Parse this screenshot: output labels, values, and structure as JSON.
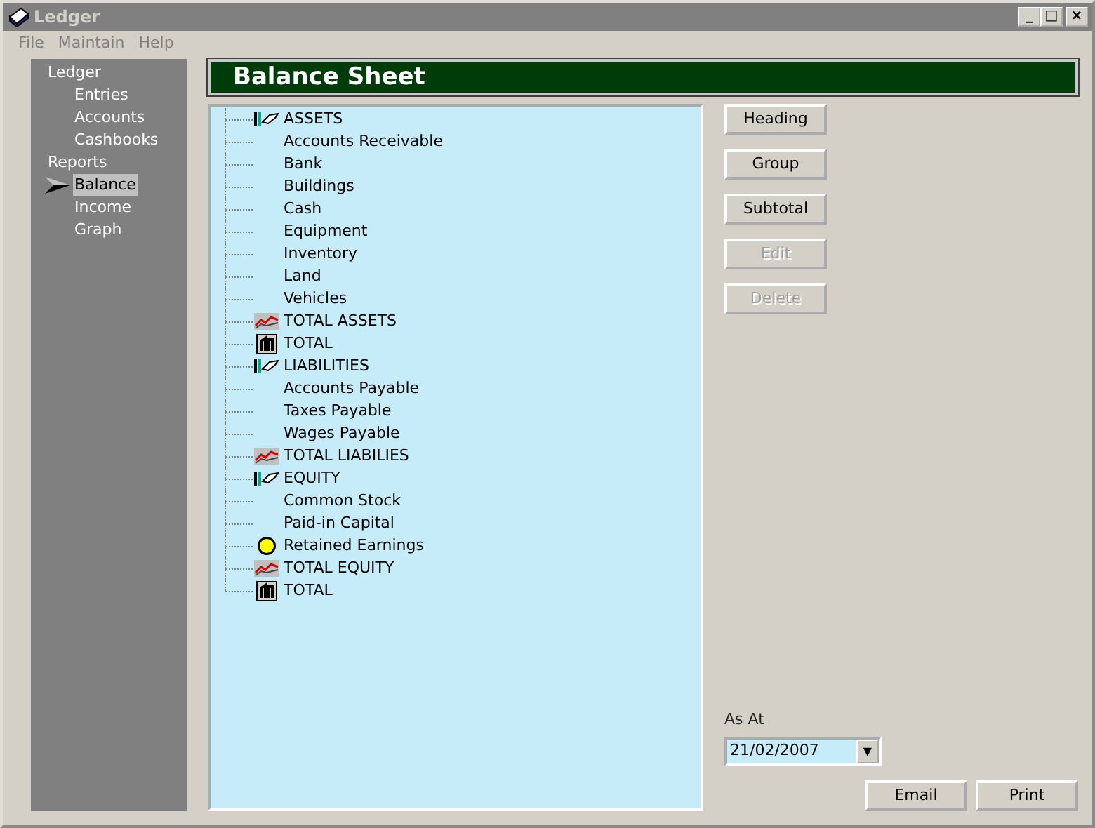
{
  "window": {
    "title": "Ledger",
    "controls": [
      "_",
      "□",
      "×"
    ]
  },
  "menu": [
    {
      "label": "File"
    },
    {
      "label": "Maintain"
    },
    {
      "label": "Help"
    }
  ],
  "sidebar": {
    "items": [
      {
        "label": "Ledger",
        "selected": false,
        "children": [
          {
            "label": "Entries",
            "selected": false
          },
          {
            "label": "Accounts",
            "selected": false
          },
          {
            "label": "Cashbooks",
            "selected": false
          }
        ]
      },
      {
        "label": "Reports",
        "selected": false,
        "children": [
          {
            "label": "Balance",
            "selected": true
          },
          {
            "label": "Income",
            "selected": false
          },
          {
            "label": "Graph",
            "selected": false
          }
        ]
      }
    ]
  },
  "header": "Balance Sheet",
  "tree": [
    {
      "label": "ASSETS",
      "kind": "heading"
    },
    {
      "label": "Accounts Receivable",
      "kind": "account"
    },
    {
      "label": "Bank",
      "kind": "account"
    },
    {
      "label": "Buildings",
      "kind": "account"
    },
    {
      "label": "Cash",
      "kind": "account"
    },
    {
      "label": "Equipment",
      "kind": "account"
    },
    {
      "label": "Inventory",
      "kind": "account"
    },
    {
      "label": "Land",
      "kind": "account"
    },
    {
      "label": "Vehicles",
      "kind": "account"
    },
    {
      "label": "TOTAL ASSETS",
      "kind": "subtotal"
    },
    {
      "label": "TOTAL",
      "kind": "total"
    },
    {
      "label": "LIABILITIES",
      "kind": "heading"
    },
    {
      "label": "Accounts Payable",
      "kind": "account"
    },
    {
      "label": "Taxes Payable",
      "kind": "account"
    },
    {
      "label": "Wages Payable",
      "kind": "account"
    },
    {
      "label": "TOTAL LIABILIES",
      "kind": "subtotal"
    },
    {
      "label": "EQUITY",
      "kind": "heading"
    },
    {
      "label": "Common Stock",
      "kind": "account"
    },
    {
      "label": "Paid-in Capital",
      "kind": "account"
    },
    {
      "label": "Retained Earnings",
      "kind": "earnings"
    },
    {
      "label": "TOTAL EQUITY",
      "kind": "subtotal"
    },
    {
      "label": "TOTAL",
      "kind": "total"
    }
  ],
  "actions": [
    {
      "label": "Heading",
      "disabled": false
    },
    {
      "label": "Group",
      "disabled": false
    },
    {
      "label": "Subtotal",
      "disabled": false
    },
    {
      "label": "Edit",
      "disabled": true
    },
    {
      "label": "Delete",
      "disabled": true
    }
  ],
  "as_at": {
    "label": "As At",
    "value": "21/02/2007",
    "arrow": "▼"
  },
  "footer_buttons": [
    {
      "label": "Email"
    },
    {
      "label": "Print"
    }
  ]
}
